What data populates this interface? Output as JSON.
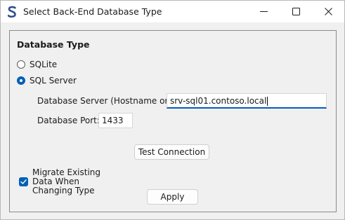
{
  "window": {
    "title": "Select Back-End Database Type",
    "icon": "s-logo-icon",
    "controls": [
      "minimize-icon",
      "maximize-icon",
      "close-icon"
    ]
  },
  "group": {
    "title": "Database Type"
  },
  "options": {
    "sqlite": {
      "label": "SQLite",
      "selected": false
    },
    "sqlserver": {
      "label": "SQL Server",
      "selected": true
    }
  },
  "server": {
    "label": "Database Server (Hostname or IP):",
    "value": "srv-sql01.contoso.local"
  },
  "port": {
    "label": "Database Port:",
    "value": "1433"
  },
  "buttons": {
    "test": "Test Connection",
    "apply": "Apply"
  },
  "migrate": {
    "checked": true,
    "lines": [
      "Migrate Existing",
      "Data When",
      "Changing Type"
    ]
  },
  "colors": {
    "accent": "#005fb8",
    "background": "#f0f0f0",
    "titlebar": "#ffffff",
    "logo": "#2f4f8f"
  }
}
